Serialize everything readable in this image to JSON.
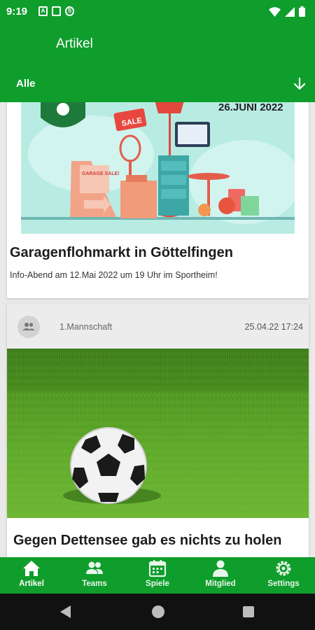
{
  "status_bar": {
    "time": "9:19"
  },
  "app_bar": {
    "title": "Artikel",
    "filter_label": "Alle"
  },
  "articles": [
    {
      "image_date_text": "26.JUNI 2022",
      "image_sale_text": "SALE",
      "image_garage_text": "GARAGE SALE!",
      "title": "Garagenflohmarkt in Göttelfingen",
      "subtitle": "Info-Abend am 12.Mai 2022 um 19 Uhr im Sportheim!"
    },
    {
      "team": "1.Mannschaft",
      "date": "25.04.22 17:24",
      "title": "Gegen Dettensee gab es nichts zu holen"
    }
  ],
  "bottom_nav": {
    "items": [
      {
        "label": "Artikel",
        "icon": "home-icon",
        "active": true
      },
      {
        "label": "Teams",
        "icon": "people-icon",
        "active": false
      },
      {
        "label": "Spiele",
        "icon": "calendar-icon",
        "active": false
      },
      {
        "label": "Mitglied",
        "icon": "person-icon",
        "active": false
      },
      {
        "label": "Settings",
        "icon": "gear-icon",
        "active": false
      }
    ]
  },
  "colors": {
    "primary": "#0f9d2c",
    "system_nav": "#111111"
  }
}
